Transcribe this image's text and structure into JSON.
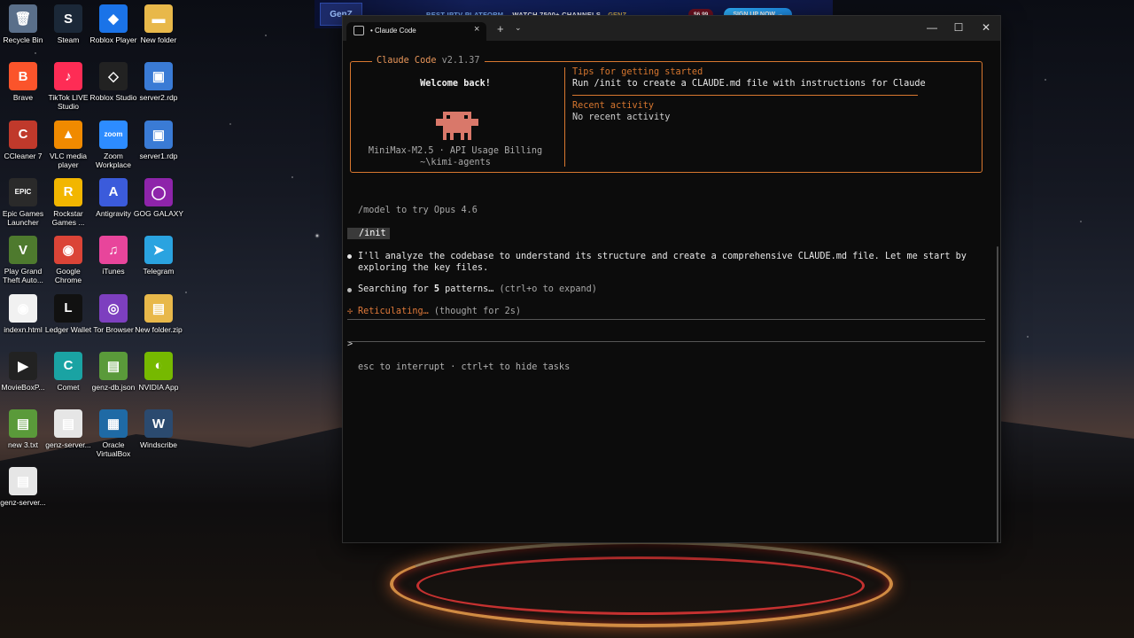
{
  "desktop": {
    "icons": [
      {
        "label": "Recycle Bin",
        "glyph": "🗑",
        "color": "#5a6f8a"
      },
      {
        "label": "Steam",
        "glyph": "S",
        "color": "#1b2838"
      },
      {
        "label": "Roblox Player",
        "glyph": "◆",
        "color": "#1a73e8"
      },
      {
        "label": "New folder",
        "glyph": "▬",
        "color": "#e8b84a"
      },
      {
        "label": "Brave",
        "glyph": "B",
        "color": "#fb542b"
      },
      {
        "label": "TikTok LIVE Studio",
        "glyph": "♪",
        "color": "#fe2c55"
      },
      {
        "label": "Roblox Studio",
        "glyph": "◇",
        "color": "#222222"
      },
      {
        "label": "server2.rdp",
        "glyph": "▣",
        "color": "#3a7bd5"
      },
      {
        "label": "CCleaner 7",
        "glyph": "C",
        "color": "#c0392b"
      },
      {
        "label": "VLC media player",
        "glyph": "▲",
        "color": "#f08a00"
      },
      {
        "label": "Zoom Workplace",
        "glyph": "zoom",
        "color": "#2d8cff"
      },
      {
        "label": "server1.rdp",
        "glyph": "▣",
        "color": "#3a7bd5"
      },
      {
        "label": "Epic Games Launcher",
        "glyph": "EPIC",
        "color": "#2a2a2a"
      },
      {
        "label": "Rockstar Games ...",
        "glyph": "R",
        "color": "#f2b600"
      },
      {
        "label": "Antigravity",
        "glyph": "A",
        "color": "#3b5bdb"
      },
      {
        "label": "GOG GALAXY",
        "glyph": "◯",
        "color": "#8e24aa"
      },
      {
        "label": "Play Grand Theft Auto...",
        "glyph": "V",
        "color": "#4e7a2e"
      },
      {
        "label": "Google Chrome",
        "glyph": "◉",
        "color": "#db4437"
      },
      {
        "label": "iTunes",
        "glyph": "♫",
        "color": "#e8459b"
      },
      {
        "label": "Telegram",
        "glyph": "➤",
        "color": "#2aa3e0"
      },
      {
        "label": "indexn.html",
        "glyph": "◉",
        "color": "#f1f1f1"
      },
      {
        "label": "Ledger Wallet",
        "glyph": "L",
        "color": "#111111"
      },
      {
        "label": "Tor Browser",
        "glyph": "◎",
        "color": "#7d3fbf"
      },
      {
        "label": "New folder.zip",
        "glyph": "▤",
        "color": "#e8b84a"
      },
      {
        "label": "MovieBoxP...",
        "glyph": "▶",
        "color": "#222222"
      },
      {
        "label": "Comet",
        "glyph": "C",
        "color": "#1aa3a3"
      },
      {
        "label": "genz-db.json",
        "glyph": "▤",
        "color": "#5a9a3a"
      },
      {
        "label": "NVIDIA App",
        "glyph": "◐",
        "color": "#76b900"
      },
      {
        "label": "new 3.txt",
        "glyph": "▤",
        "color": "#5a9a3a"
      },
      {
        "label": "genz-server...",
        "glyph": "▤",
        "color": "#e6e6e6"
      },
      {
        "label": "Oracle VirtualBox",
        "glyph": "▦",
        "color": "#1f6aa5"
      },
      {
        "label": "Windscribe",
        "glyph": "W",
        "color": "#2b4a6f"
      },
      {
        "label": "genz-server...",
        "glyph": "▤",
        "color": "#e6e6e6"
      }
    ]
  },
  "ad": {
    "logo": "GenZ",
    "headline": "BEST IPTV PLATFORM",
    "sub": "WATCH 7500+ CHANNELS",
    "brand": "GENZ",
    "price": "$6.99",
    "cta": "SIGN UP NOW →"
  },
  "window": {
    "tab_title": "• Claude Code",
    "tab_close": "×",
    "new_tab": "+",
    "dropdown": "⌄",
    "minimize": "—",
    "maximize": "☐",
    "close": "✕"
  },
  "panel": {
    "app_name": "Claude Code",
    "version": "v2.1.37",
    "welcome": "Welcome back!",
    "model_line": "MiniMax-M2.5 · API Usage Billing",
    "directory": "~\\kimi-agents",
    "tips_heading": "Tips for getting started",
    "tips_body": "Run /init to create a CLAUDE.md file with instructions for Claude",
    "recent_heading": "Recent activity",
    "recent_body": "No recent activity"
  },
  "session": {
    "model_hint": "/model to try Opus 4.6",
    "command": "/init",
    "message": "I'll analyze the codebase to understand its structure and create a comprehensive CLAUDE.md file. Let me start by exploring the key files.",
    "search_prefix": "Searching for ",
    "search_count": "5",
    "search_suffix": " patterns…",
    "search_hint": "(ctrl+o to expand)",
    "spinner": "✢",
    "status": "Reticulating…",
    "status_hint": "(thought for 2s)",
    "prompt": ">",
    "footer": "esc to interrupt · ctrl+t to hide tasks"
  },
  "colors": {
    "accent": "#d8772f",
    "background": "#0c0c0c"
  }
}
